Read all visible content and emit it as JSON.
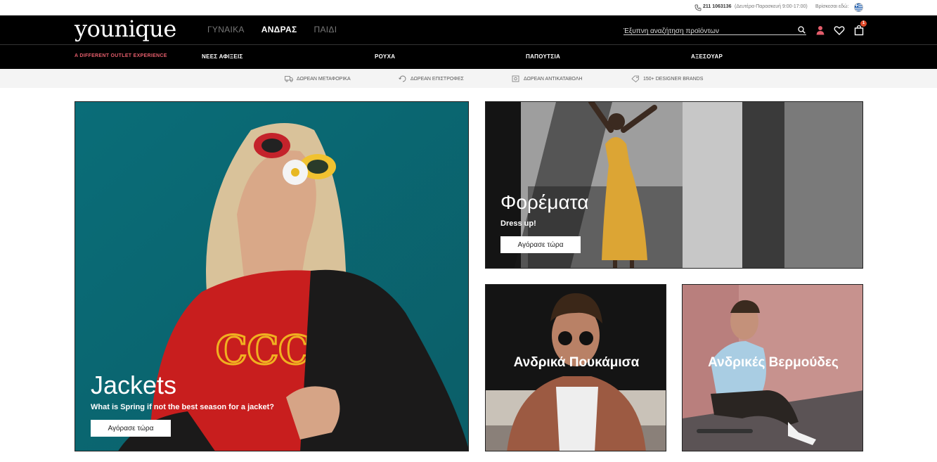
{
  "topbar": {
    "phone": "211 1063136",
    "hours": "(Δευτέρα-Παρασκευή 9:00-17:00)",
    "located": "Βρίσκεσαι εδώ:"
  },
  "header": {
    "logo": "younique",
    "nav": [
      "ΓΥΝΑΙΚΑ",
      "ΑΝΔΡΑΣ",
      "ΠΑΙΔΙ"
    ],
    "active_nav": "ΑΝΔΡΑΣ",
    "search_placeholder": "Έξυπνη αναζήτηση προϊόντων",
    "cart_count": "1"
  },
  "categories": {
    "tagline": "A DIFFERENT OUTLET EXPERIENCE",
    "items": [
      "ΝΕΕΣ ΑΦΙΞΕΙΣ",
      "ΡΟΥΧΑ",
      "ΠΑΠΟΥΤΣΙΑ",
      "ΑΞΕΣΟΥΑΡ"
    ]
  },
  "benefits": [
    "ΔΩΡΕΑΝ ΜΕΤΑΦΟΡΙΚΑ",
    "ΔΩΡΕΑΝ ΕΠΙΣΤΡΟΦΕΣ",
    "ΔΩΡΕΑΝ ΑΝΤΙΚΑΤΑΒΟΛΗ",
    "150+ DESIGNER BRANDS"
  ],
  "tiles": {
    "jackets": {
      "title": "Jackets",
      "subtitle": "What is Spring if not the best season for a jacket?",
      "button": "Αγόρασε τώρα"
    },
    "dresses": {
      "title": "Φορέματα",
      "subtitle": "Dress up!",
      "button": "Αγόρασε τώρα"
    },
    "shirts": {
      "title": "Ανδρικά Πουκάμισα"
    },
    "shorts": {
      "title": "Ανδρικές Βερμούδες"
    }
  },
  "colors": {
    "accent": "#e45d6b",
    "badge": "#e04a2a",
    "teal": "#0e6e78"
  }
}
